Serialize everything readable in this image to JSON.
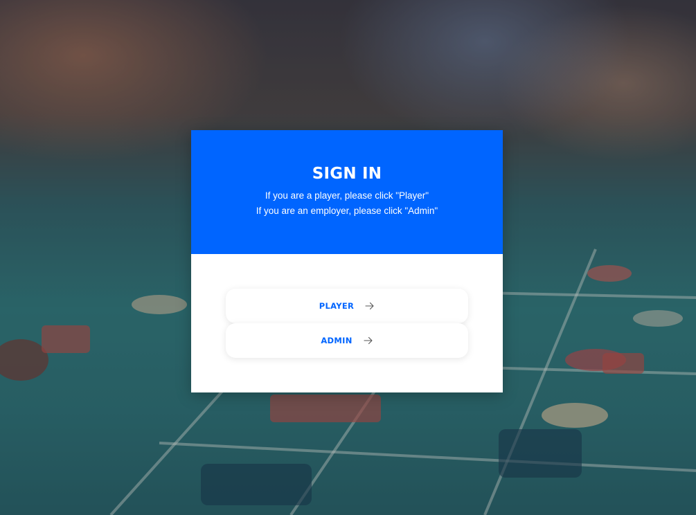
{
  "signin": {
    "title": "SIGN IN",
    "line1": "If you are a player, please click \"Player\"",
    "line2": "If you are an employer, please click \"Admin\""
  },
  "buttons": {
    "player_label": "PLAYER",
    "admin_label": "ADMIN",
    "icon": "arrow-right-icon"
  },
  "colors": {
    "accent": "#0065ff",
    "card_background": "#ffffff"
  }
}
